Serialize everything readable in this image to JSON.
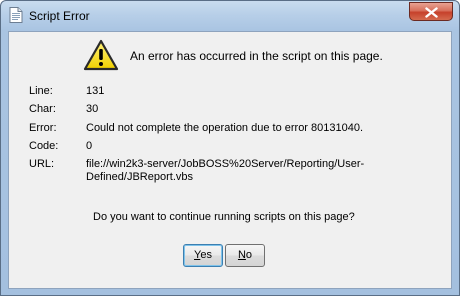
{
  "window": {
    "title": "Script Error"
  },
  "dialog": {
    "headline": "An error has occurred in the script on this page.",
    "details": [
      {
        "label": "Line:",
        "value": "131"
      },
      {
        "label": "Char:",
        "value": "30"
      },
      {
        "label": "Error:",
        "value": "Could not complete the operation due to error 80131040."
      },
      {
        "label": "Code:",
        "value": "0"
      },
      {
        "label": "URL:",
        "value_line1": "file://win2k3-server/JobBOSS%20Server/Reporting/User-",
        "value_line2": "Defined/JBReport.vbs"
      }
    ],
    "question": "Do you want to continue running scripts on this page?",
    "buttons": {
      "yes": {
        "mnemonic": "Y",
        "rest": "es"
      },
      "no": {
        "mnemonic": "N",
        "rest": "o"
      }
    }
  },
  "icons": {
    "title": "document-icon",
    "warning": "warning-icon",
    "close": "close-icon"
  },
  "colors": {
    "titlebar": "#b7cfe8",
    "close_button": "#c6412b",
    "client_background": "#f0f0f0",
    "warning_fill": "#f4e11d",
    "default_button_border": "#3c7fb1"
  }
}
